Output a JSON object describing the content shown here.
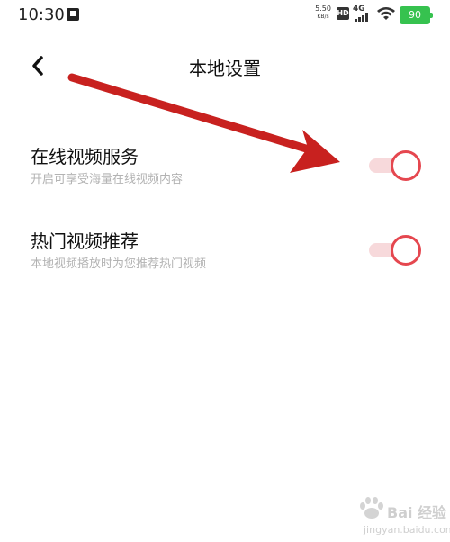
{
  "status_bar": {
    "time": "10:30",
    "net_speed_value": "5.50",
    "net_speed_unit": "KB/s",
    "hd_label": "HD",
    "network_type": "4G",
    "battery_level": "90",
    "battery_color": "#36c24f"
  },
  "header": {
    "title": "本地设置"
  },
  "settings": [
    {
      "label": "在线视频服务",
      "description": "开启可享受海量在线视频内容",
      "enabled": true
    },
    {
      "label": "热门视频推荐",
      "description": "本地视频播放时为您推荐热门视频",
      "enabled": true
    }
  ],
  "colors": {
    "toggle_on_knob_border": "#e5474f",
    "toggle_on_track": "#f7d9db",
    "annotation_arrow": "#c8211f"
  },
  "watermark": {
    "text": "Bai 经验",
    "url": "jingyan.baidu.com"
  }
}
